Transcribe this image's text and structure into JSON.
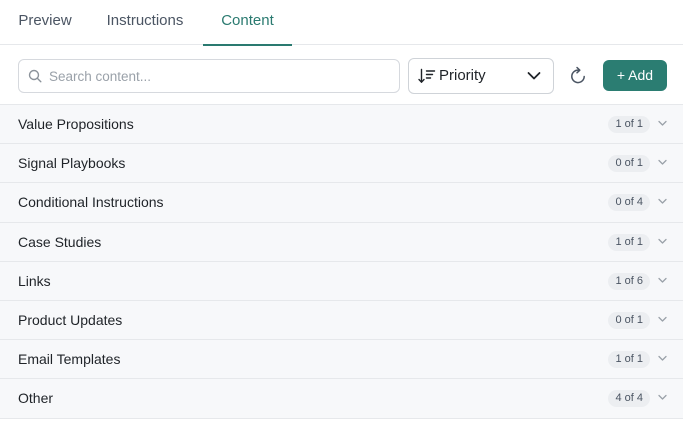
{
  "tabs": [
    {
      "label": "Preview",
      "active": false
    },
    {
      "label": "Instructions",
      "active": false
    },
    {
      "label": "Content",
      "active": true
    }
  ],
  "toolbar": {
    "search_placeholder": "Search content...",
    "search_value": "",
    "sort_label": "Priority",
    "add_label": "+ Add"
  },
  "sections": [
    {
      "label": "Value Propositions",
      "count": "1 of 1"
    },
    {
      "label": "Signal Playbooks",
      "count": "0 of 1"
    },
    {
      "label": "Conditional Instructions",
      "count": "0 of 4"
    },
    {
      "label": "Case Studies",
      "count": "1 of 1"
    },
    {
      "label": "Links",
      "count": "1 of 6"
    },
    {
      "label": "Product Updates",
      "count": "0 of 1"
    },
    {
      "label": "Email Templates",
      "count": "1 of 1"
    },
    {
      "label": "Other",
      "count": "4 of 4"
    }
  ],
  "colors": {
    "accent": "#2a7a70",
    "button": "#2b7d72",
    "row_bg": "#f7f8fa",
    "badge_bg": "#eceef1"
  },
  "icons": {
    "search": "search-icon",
    "sort": "sort-descending-icon",
    "dropdown": "chevron-down-icon",
    "refresh": "refresh-icon",
    "expand": "chevron-down-icon"
  }
}
